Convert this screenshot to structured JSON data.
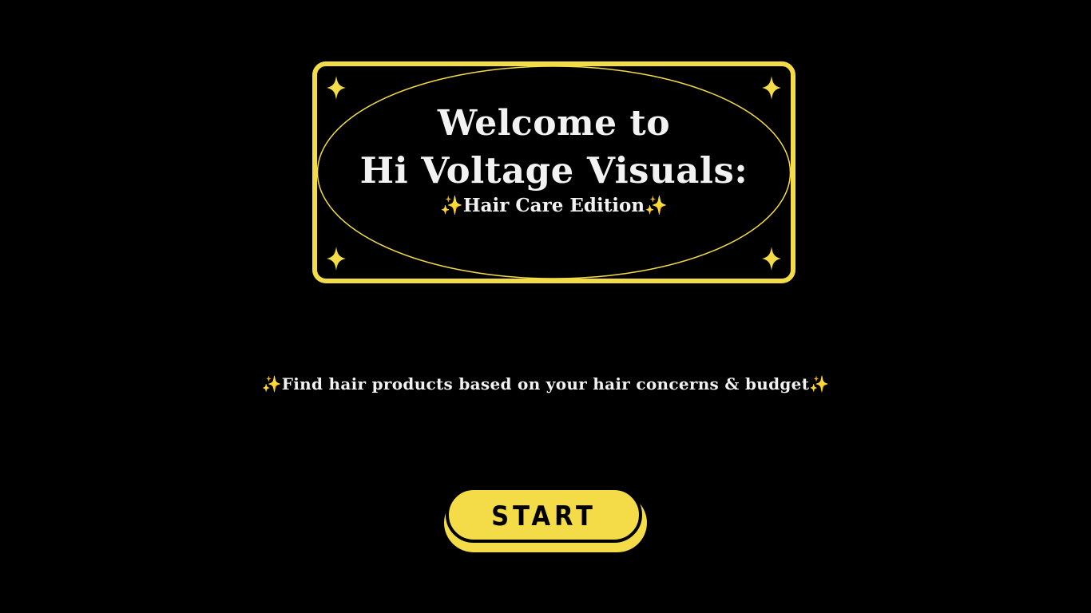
{
  "hero": {
    "title_line1": "Welcome to",
    "title_line2": "Hi Voltage Visuals:",
    "subtitle": "Hair Care Edition",
    "sparkle_emoji": "✨",
    "corner_icon": "four-point-star-icon"
  },
  "tagline": {
    "text": "Find hair products based on your hair concerns & budget"
  },
  "start_button": {
    "label": "START"
  },
  "colors": {
    "background": "#000000",
    "accent": "#f3dc47",
    "sparkle": "#f6c344",
    "text": "#f2f2f2"
  }
}
